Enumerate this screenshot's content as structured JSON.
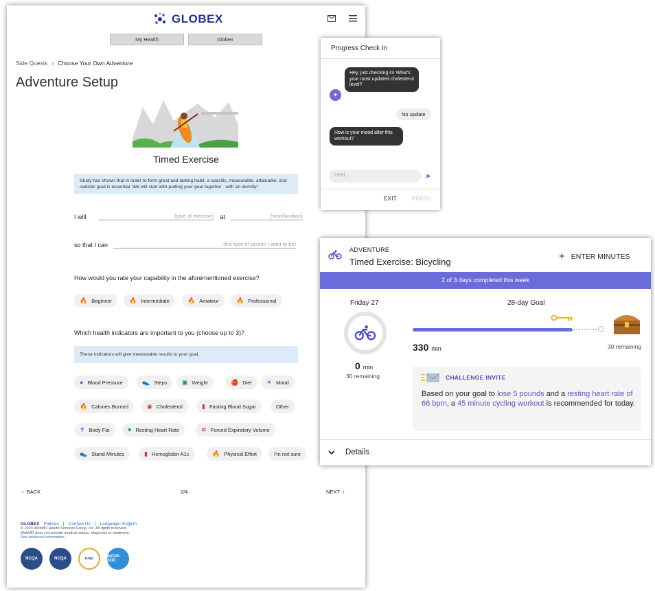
{
  "header": {
    "brand": "GLOBEX",
    "mail_icon": "mail-icon",
    "menu_icon": "hamburger-icon"
  },
  "tabs": [
    {
      "label": "My Health"
    },
    {
      "label": "Globex"
    }
  ],
  "breadcrumb": {
    "parent": "Side Quests",
    "current": "Choose Your Own Adventure"
  },
  "page_title": "Adventure Setup",
  "subtitle": "Timed Exercise",
  "intro_note": "Study has shown that in order to form great and lasting habit, a specific, measurable, attainable, and realistic goal is essential. We will start with putting your goal together - with an identity!",
  "form": {
    "i_will": "I will",
    "exercise_placeholder": "(type of exercise)",
    "at": "at",
    "time_placeholder": "(time/location)",
    "so_that": "so that I can",
    "person_placeholder": "(the type of person I want to be)"
  },
  "capability": {
    "question": "How would you rate your capability in the aforementioned exercise?",
    "options": [
      {
        "label": "Beginner"
      },
      {
        "label": "Intermediate"
      },
      {
        "label": "Amateur"
      },
      {
        "label": "Professional"
      }
    ]
  },
  "indicators": {
    "question": "Which health indicators are important to you (choose up to 3)?",
    "note": "These indicators will give measurable results to your goal.",
    "options": [
      {
        "label": "Blood Pressure"
      },
      {
        "label": "Steps"
      },
      {
        "label": "Weight"
      },
      {
        "label": "Diet"
      },
      {
        "label": "Mood"
      },
      {
        "label": "Calories Burned"
      },
      {
        "label": "Cholesterol"
      },
      {
        "label": "Fasting Blood Sugar"
      },
      {
        "label": "Other"
      },
      {
        "label": "Body Fat"
      },
      {
        "label": "Resting Heart Rate"
      },
      {
        "label": "Forced Expiratory Volume"
      },
      {
        "label": "Stand Minutes"
      },
      {
        "label": "Hemoglobin A1c"
      },
      {
        "label": "Physical Effort"
      },
      {
        "label": "I'm not sure"
      }
    ]
  },
  "pager": {
    "back": "BACK",
    "page": "2/4",
    "next": "NEXT"
  },
  "footer": {
    "brand": "GLOBEX",
    "policies": "Policies",
    "contact": "Contact Us",
    "language": "Language: English",
    "copyright": "© 2023 WebMD Health Services Group, Inc. All rights reserved.",
    "disclaimer": "WebMD does not provide medical advice, diagnosis or treatment.",
    "more": "See additional information.",
    "badges": [
      "NCQA",
      "NCQA",
      "urac",
      "AICPA SOC"
    ]
  },
  "chat": {
    "title": "Progress Check In",
    "msg1": "Hey, just checking in! What's your most updated cholesterol level?",
    "reply1": "No update",
    "msg2": "How is your mood after this workout?",
    "input_placeholder": "I feel...",
    "exit": "EXIT",
    "finish": "FINISH"
  },
  "card": {
    "eyebrow": "ADVENTURE",
    "title": "Timed Exercise: Bicycling",
    "enter_minutes": "ENTER MINUTES",
    "banner": "2 of 3 days completed this week",
    "day": "Friday 27",
    "today_minutes": "0",
    "min_unit": "min",
    "today_remaining": "30 remaining",
    "goal_title": "28-day Goal",
    "goal_progress": 0.92,
    "goal_minutes": "330",
    "goal_remaining": "30 remaining",
    "invite_heading": "CHALLENGE INVITE",
    "invite_pre": "Based on your goal to ",
    "invite_goal1": "lose 5 pounds",
    "invite_mid1": " and a ",
    "invite_goal2": "resting heart rate of 66 bpm",
    "invite_mid2": ", a ",
    "invite_goal3": "45 minute cycling workout",
    "invite_post": " is recommended for today.",
    "details": "Details"
  },
  "colors": {
    "accent": "#6b6cdc",
    "brand": "#23308c",
    "note_bg": "#dcebf7"
  }
}
